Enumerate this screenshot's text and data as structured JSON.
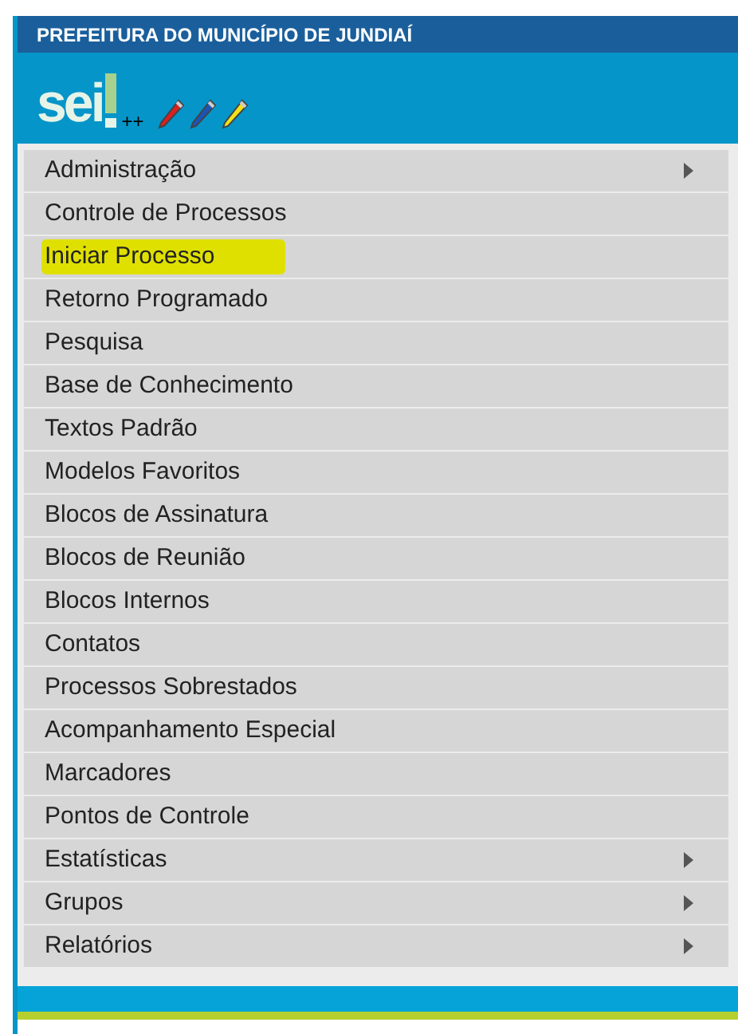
{
  "header": {
    "title": "PREFEITURA DO MUNICÍPIO DE JUNDIAÍ"
  },
  "logo": {
    "text": "sei",
    "suffix": "++"
  },
  "menu": [
    {
      "label": "Administração",
      "has_submenu": true,
      "highlighted": false
    },
    {
      "label": "Controle de Processos",
      "has_submenu": false,
      "highlighted": false
    },
    {
      "label": "Iniciar Processo",
      "has_submenu": false,
      "highlighted": true
    },
    {
      "label": "Retorno Programado",
      "has_submenu": false,
      "highlighted": false
    },
    {
      "label": "Pesquisa",
      "has_submenu": false,
      "highlighted": false
    },
    {
      "label": "Base de Conhecimento",
      "has_submenu": false,
      "highlighted": false
    },
    {
      "label": "Textos Padrão",
      "has_submenu": false,
      "highlighted": false
    },
    {
      "label": "Modelos Favoritos",
      "has_submenu": false,
      "highlighted": false
    },
    {
      "label": "Blocos de Assinatura",
      "has_submenu": false,
      "highlighted": false
    },
    {
      "label": "Blocos de Reunião",
      "has_submenu": false,
      "highlighted": false
    },
    {
      "label": "Blocos Internos",
      "has_submenu": false,
      "highlighted": false
    },
    {
      "label": "Contatos",
      "has_submenu": false,
      "highlighted": false
    },
    {
      "label": "Processos Sobrestados",
      "has_submenu": false,
      "highlighted": false
    },
    {
      "label": "Acompanhamento Especial",
      "has_submenu": false,
      "highlighted": false
    },
    {
      "label": "Marcadores",
      "has_submenu": false,
      "highlighted": false
    },
    {
      "label": "Pontos de Controle",
      "has_submenu": false,
      "highlighted": false
    },
    {
      "label": "Estatísticas",
      "has_submenu": true,
      "highlighted": false
    },
    {
      "label": "Grupos",
      "has_submenu": true,
      "highlighted": false
    },
    {
      "label": "Relatórios",
      "has_submenu": true,
      "highlighted": false
    }
  ]
}
